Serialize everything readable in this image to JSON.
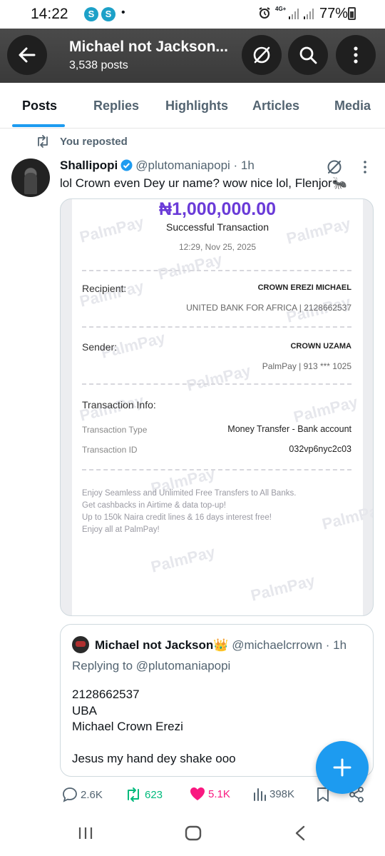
{
  "status_bar": {
    "time": "14:22",
    "dot": "•",
    "network": "4G+",
    "battery": "77%"
  },
  "header": {
    "title": "Michael not Jackson...",
    "posts_count": "3,538 posts",
    "icons": [
      "back-arrow-icon",
      "grok-icon",
      "search-icon",
      "more-vertical-icon"
    ]
  },
  "tabs": [
    {
      "label": "Posts",
      "active": true
    },
    {
      "label": "Replies",
      "active": false
    },
    {
      "label": "Highlights",
      "active": false
    },
    {
      "label": "Articles",
      "active": false
    },
    {
      "label": "Media",
      "active": false
    }
  ],
  "repost_label": "You reposted",
  "post": {
    "author_name": "Shallipopi",
    "handle": "@plutomaniapopi · 1h",
    "text": "lol Crown even Dey ur name? wow nice lol, Flenjor🐜",
    "receipt": {
      "amount": "₦1,000,000.00",
      "status": "Successful Transaction",
      "date": "12:29, Nov 25, 2025",
      "recipient_label": "Recipient:",
      "recipient_name": "CROWN EREZI MICHAEL",
      "recipient_bank": "UNITED BANK FOR AFRICA | 2128662537",
      "sender_label": "Sender:",
      "sender_name": "CROWN UZAMA",
      "sender_bank": "PalmPay | 913 *** 1025",
      "info_label": "Transaction Info:",
      "type_label": "Transaction Type",
      "type_value": "Money Transfer - Bank account",
      "id_label": "Transaction ID",
      "id_value": "032vp6nyc2c03",
      "promo_lines": [
        "Enjoy Seamless and Unlimited Free Transfers to All Banks.",
        "Get cashbacks in Airtime & data top-up!",
        "Up to 150k Naira credit lines & 16 days interest free!",
        "Enjoy all at PalmPay!"
      ],
      "watermark": "PalmPay"
    },
    "quote": {
      "author_name": "Michael not Jackson👑",
      "handle": "@michaelcrrown · 1h",
      "replying_to": "Replying to @plutomaniapopi",
      "lines": [
        "2128662537",
        "UBA",
        "Michael Crown Erezi",
        "",
        "Jesus my hand dey shake ooo"
      ]
    },
    "actions": {
      "replies": "2.6K",
      "reposts": "623",
      "likes": "5.1K",
      "views": "398K"
    }
  },
  "colors": {
    "accent": "#1d9bf0",
    "repost_green": "#00ba7c",
    "like_pink": "#f91880",
    "palmpay_purple": "#6a3bd8"
  }
}
